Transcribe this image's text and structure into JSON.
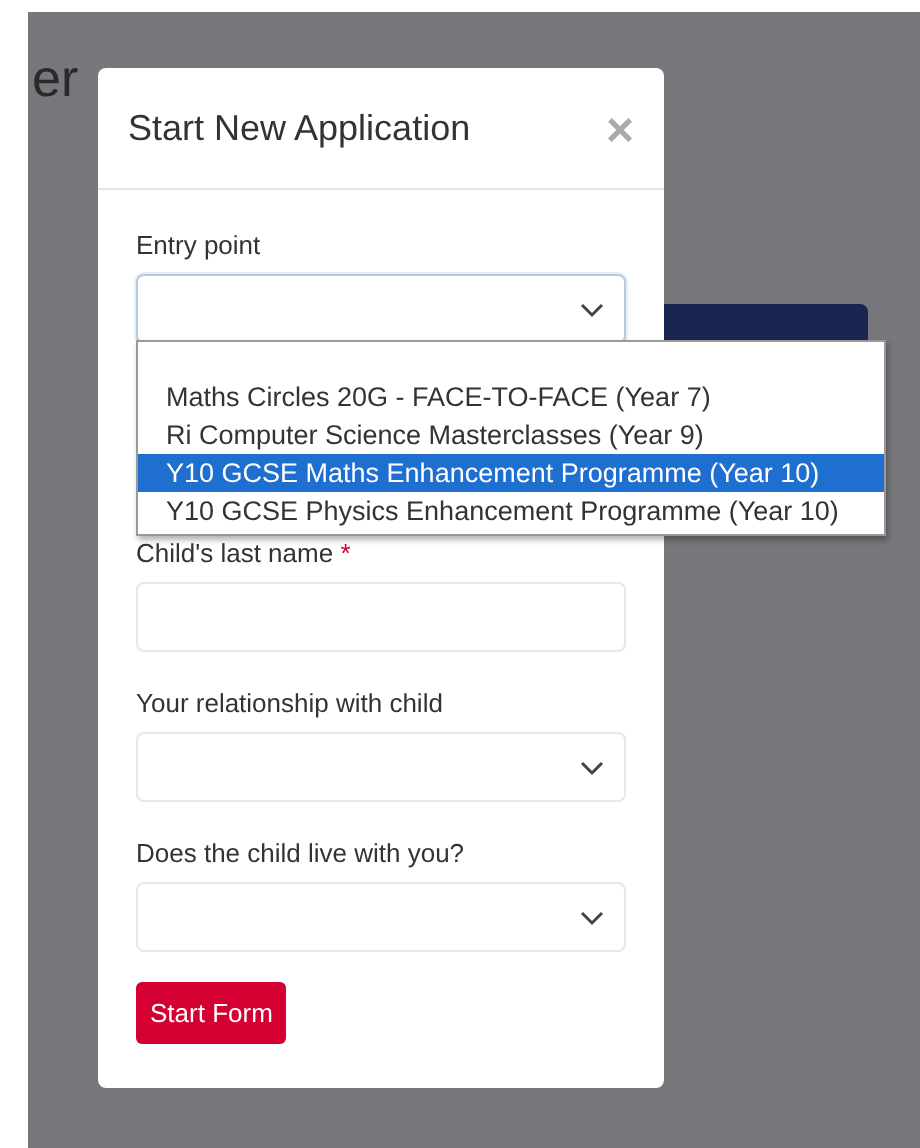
{
  "background": {
    "heading_fragment": "er"
  },
  "modal": {
    "title": "Start New Application",
    "close": "×",
    "fields": [
      {
        "kind": "select",
        "label": "Entry point",
        "expanded": true
      },
      {
        "kind": "text",
        "label": "Child's last name",
        "required_mark": "*"
      },
      {
        "kind": "select",
        "label": "Your relationship with child",
        "expanded": false
      },
      {
        "kind": "select",
        "label": "Does the child live with you?",
        "expanded": false
      }
    ],
    "dropdown_options": [
      {
        "label": "Maths Circles 20G - FACE-TO-FACE (Year 7)",
        "selected": false
      },
      {
        "label": "Ri Computer Science Masterclasses (Year 9)",
        "selected": false
      },
      {
        "label": "Y10 GCSE Maths Enhancement Programme (Year 10)",
        "selected": true
      },
      {
        "label": "Y10 GCSE Physics Enhancement Programme (Year 10)",
        "selected": false
      }
    ],
    "submit": "Start Form"
  }
}
